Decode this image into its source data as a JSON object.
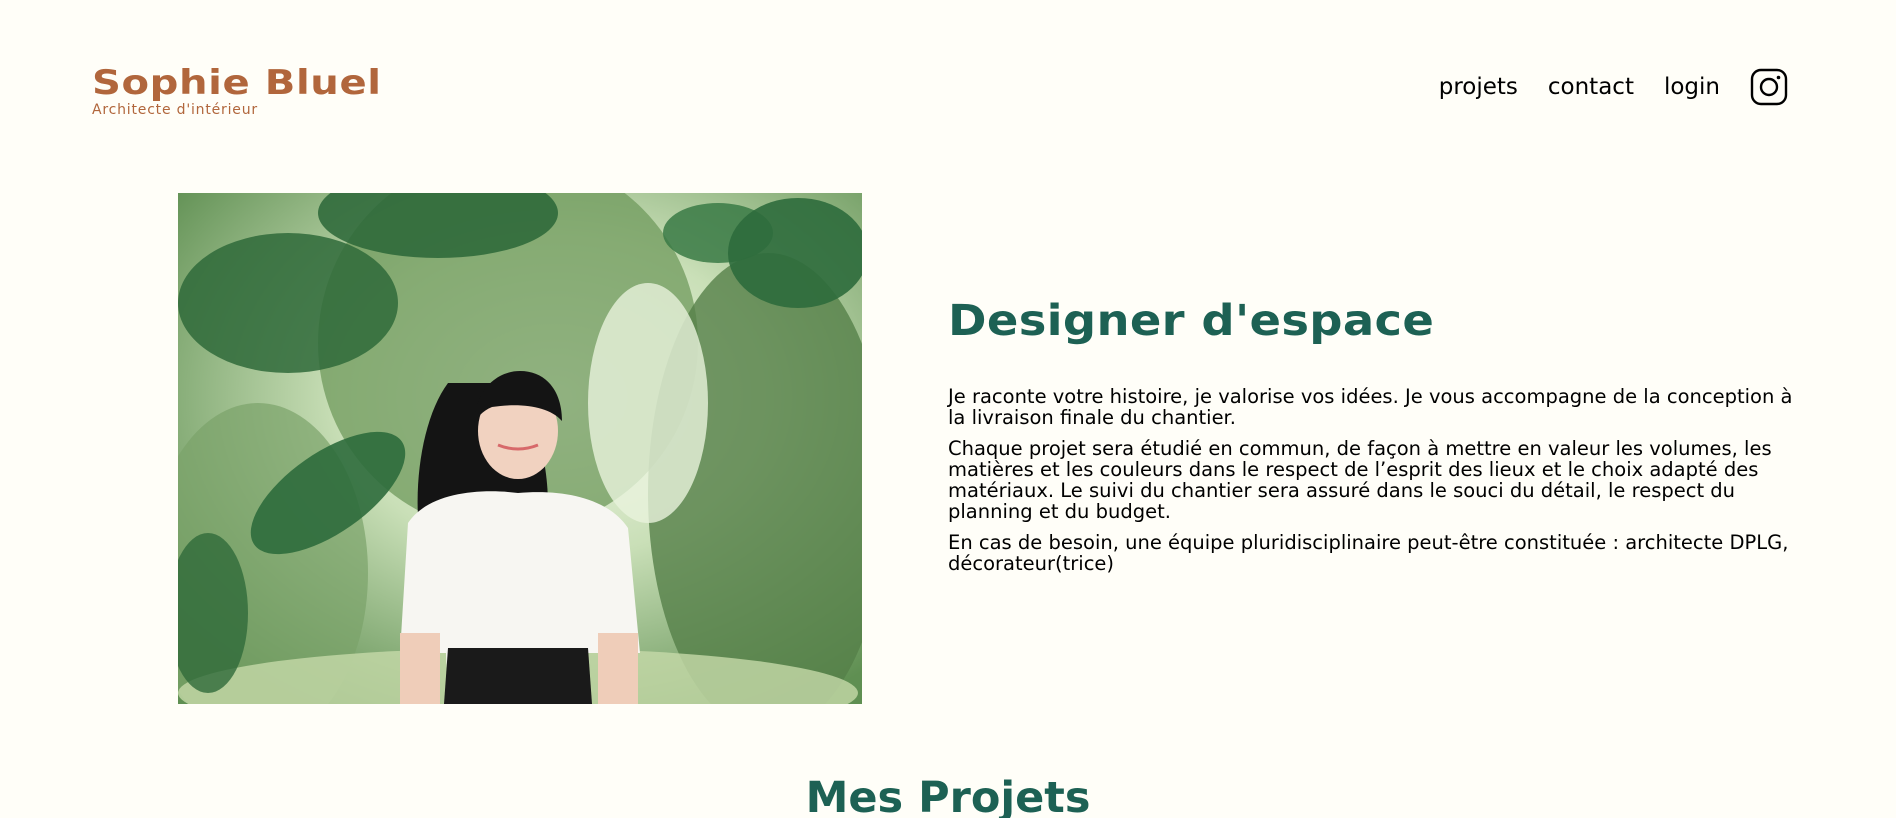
{
  "header": {
    "logo_title": "Sophie Bluel",
    "logo_subtitle": "Architecte d'intérieur",
    "nav": {
      "projets": "projets",
      "contact": "contact",
      "login": "login",
      "instagram_icon": "instagram-icon"
    }
  },
  "introduction": {
    "title": "Designer d'espace",
    "paragraphs": [
      "Je raconte votre histoire, je valorise vos idées. Je vous accompagne de la conception à la livraison finale du chantier.",
      "Chaque projet sera étudié en commun, de façon à mettre en valeur les volumes, les matières et les couleurs dans le respect de l’esprit des lieux et le choix adapté des matériaux. Le suivi du chantier sera assuré dans le souci du détail, le respect du planning et du budget.",
      "En cas de besoin, une équipe pluridisciplinaire peut-être constituée : architecte DPLG, décorateur(trice)"
    ]
  },
  "portfolio": {
    "title": "Mes Projets"
  },
  "colors": {
    "accent": "#b1663c",
    "heading": "#1d6154",
    "background": "#fffef8"
  }
}
